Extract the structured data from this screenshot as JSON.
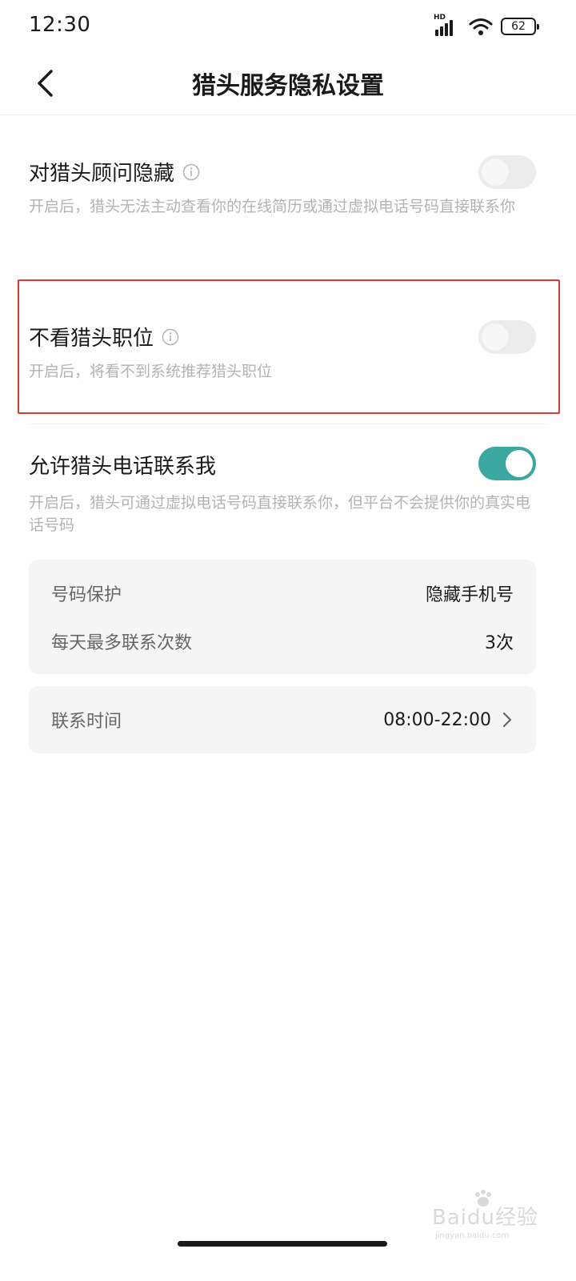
{
  "status_bar": {
    "time": "12:30",
    "network_label": "HD",
    "battery_level": "62"
  },
  "nav": {
    "back_icon": "chevron-left-icon",
    "title": "猎头服务隐私设置"
  },
  "settings": [
    {
      "title": "对猎头顾问隐藏",
      "has_info_icon": true,
      "description": "开启后，猎头无法主动查看你的在线简历或通过虚拟电话号码直接联系你",
      "toggle_on": false
    },
    {
      "title": "不看猎头职位",
      "has_info_icon": true,
      "description": "开启后，将看不到系统推荐猎头职位",
      "toggle_on": false
    },
    {
      "title": "允许猎头电话联系我",
      "has_info_icon": false,
      "description": "开启后，猎头可通过虚拟电话号码直接联系你，但平台不会提供你的真实电话号码",
      "toggle_on": true
    }
  ],
  "phone_card": {
    "rows": [
      {
        "label": "号码保护",
        "value": "隐藏手机号"
      },
      {
        "label": "每天最多联系次数",
        "value": "3次"
      }
    ]
  },
  "time_card": {
    "label": "联系时间",
    "value": "08:00-22:00"
  },
  "watermark": {
    "text": "Baidu经验",
    "sub": "jingyan.baidu.com"
  },
  "colors": {
    "toggle_on": "#3aa8a0",
    "toggle_off": "#ececec",
    "highlight": "#d93a34",
    "card_bg": "#f5f5f5"
  }
}
